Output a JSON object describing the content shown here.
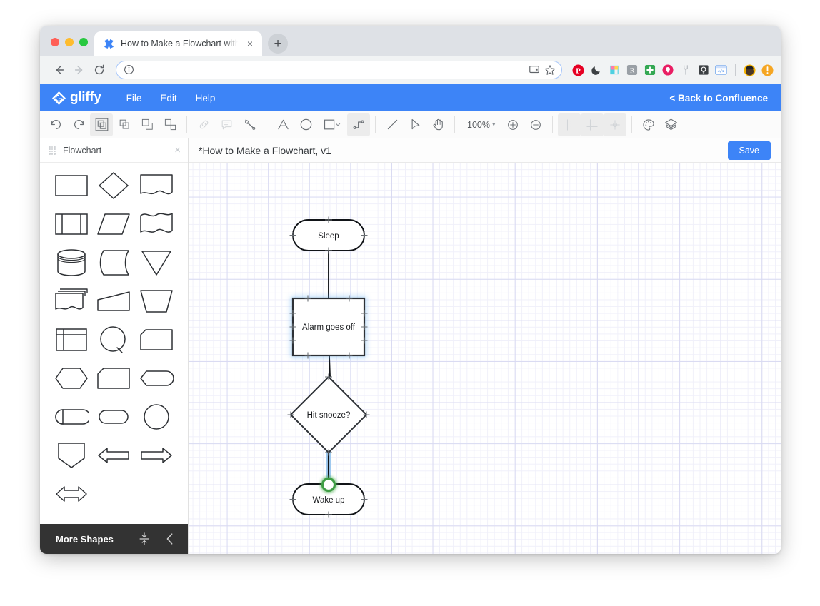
{
  "browser": {
    "tab": {
      "title": "How to Make a Flowchart with",
      "favicon": "gliffy-favicon",
      "close": "×"
    },
    "new_tab_label": "+",
    "omnibox": {
      "value": "",
      "placeholder": "",
      "info_icon": "site-info-icon"
    },
    "nav": {
      "back": "←",
      "forward": "→",
      "reload": "↻"
    },
    "toolbar_icons": [
      {
        "name": "cast-icon",
        "glyph": "",
        "color": "#5f6368"
      },
      {
        "name": "bookmark-star-icon",
        "glyph": "☆",
        "color": "#5f6368"
      },
      {
        "name": "pinterest-extension-icon",
        "glyph": "P",
        "color": "#e60023"
      },
      {
        "name": "dark-mode-extension-icon",
        "glyph": "☾",
        "color": "#3c4043"
      },
      {
        "name": "color-picker-extension-icon",
        "glyph": "",
        "color": "#4dd0e1"
      },
      {
        "name": "grammar-extension-icon",
        "glyph": "R",
        "color": "#9aa0a6"
      },
      {
        "name": "add-extension-icon",
        "glyph": "+",
        "color": "#34a853"
      },
      {
        "name": "tag-extension-icon",
        "glyph": "●",
        "color": "#e91e63"
      },
      {
        "name": "tools-extension-icon",
        "glyph": "⑂",
        "color": "#bdc1c6"
      },
      {
        "name": "lightbulb-extension-icon",
        "glyph": "●",
        "color": "#3c4043"
      },
      {
        "name": "code-extension-icon",
        "glyph": "</>",
        "color": "#1a73e8"
      }
    ],
    "profile_avatar": "user-avatar",
    "update_badge": "!"
  },
  "app": {
    "brand": "gliffy",
    "menu": [
      {
        "label": "File",
        "name": "menu-file"
      },
      {
        "label": "Edit",
        "name": "menu-edit"
      },
      {
        "label": "Help",
        "name": "menu-help"
      }
    ],
    "back_link": "< Back to Confluence",
    "accent_color": "#3d84f7"
  },
  "toolbar": {
    "zoom_level": "100%",
    "groups": [
      {
        "name": "history",
        "tools": [
          {
            "name": "undo-icon",
            "label": "Undo",
            "disabled": false
          },
          {
            "name": "redo-icon",
            "label": "Redo",
            "disabled": false
          }
        ]
      },
      {
        "name": "arrange",
        "tools": [
          {
            "name": "group-icon",
            "label": "Group",
            "disabled": false,
            "active": true
          },
          {
            "name": "ungroup-icon",
            "label": "Ungroup",
            "disabled": false
          },
          {
            "name": "bring-to-front-icon",
            "label": "Bring to front",
            "disabled": false
          },
          {
            "name": "send-to-back-icon",
            "label": "Send to back",
            "disabled": false
          }
        ]
      },
      {
        "name": "annotate",
        "tools": [
          {
            "name": "link-icon",
            "label": "Link",
            "disabled": true
          },
          {
            "name": "comment-icon",
            "label": "Comment",
            "disabled": true
          },
          {
            "name": "format-painter-icon",
            "label": "Format painter",
            "disabled": false
          }
        ]
      },
      {
        "name": "draw",
        "tools": [
          {
            "name": "text-icon",
            "label": "Text",
            "disabled": false
          },
          {
            "name": "ellipse-icon",
            "label": "Ellipse",
            "disabled": false
          },
          {
            "name": "rectangle-icon",
            "label": "Rectangle",
            "disabled": false,
            "has_caret": true
          },
          {
            "name": "connector-icon",
            "label": "Connector",
            "disabled": false,
            "active": true
          }
        ]
      },
      {
        "name": "select",
        "tools": [
          {
            "name": "line-icon",
            "label": "Line",
            "disabled": false
          },
          {
            "name": "pointer-icon",
            "label": "Select",
            "disabled": false
          },
          {
            "name": "hand-icon",
            "label": "Pan",
            "disabled": false
          }
        ]
      },
      {
        "name": "zoom",
        "tools": [
          {
            "name": "zoom-in-icon",
            "label": "Zoom in",
            "disabled": false
          },
          {
            "name": "zoom-out-icon",
            "label": "Zoom out",
            "disabled": false
          }
        ]
      },
      {
        "name": "view",
        "tools": [
          {
            "name": "guides-icon",
            "label": "Guides",
            "disabled": false,
            "active": true
          },
          {
            "name": "grid-icon",
            "label": "Grid",
            "disabled": false,
            "active": true
          },
          {
            "name": "snap-icon",
            "label": "Snap",
            "disabled": false,
            "active": true
          }
        ]
      },
      {
        "name": "style",
        "tools": [
          {
            "name": "palette-icon",
            "label": "Theme",
            "disabled": false
          },
          {
            "name": "layers-icon",
            "label": "Layers",
            "disabled": false
          }
        ]
      }
    ]
  },
  "sidebar": {
    "panel_title": "Flowchart",
    "close_label": "×",
    "more_shapes_label": "More Shapes",
    "shapes": [
      {
        "name": "shape-process",
        "label": "Process"
      },
      {
        "name": "shape-decision",
        "label": "Decision"
      },
      {
        "name": "shape-document",
        "label": "Document"
      },
      {
        "name": "shape-predefined-process",
        "label": "Predefined Process"
      },
      {
        "name": "shape-data",
        "label": "Data"
      },
      {
        "name": "shape-multi-document",
        "label": "Multi Document"
      },
      {
        "name": "shape-database",
        "label": "Database"
      },
      {
        "name": "shape-stored-data",
        "label": "Stored Data"
      },
      {
        "name": "shape-merge",
        "label": "Merge"
      },
      {
        "name": "shape-stacked-document",
        "label": "Stacked Document"
      },
      {
        "name": "shape-manual-input",
        "label": "Manual Input"
      },
      {
        "name": "shape-manual-operation",
        "label": "Manual Operation"
      },
      {
        "name": "shape-internal-storage",
        "label": "Internal Storage"
      },
      {
        "name": "shape-connector-circle",
        "label": "Connector"
      },
      {
        "name": "shape-card",
        "label": "Card"
      },
      {
        "name": "shape-preparation",
        "label": "Preparation"
      },
      {
        "name": "shape-loop-limit",
        "label": "Loop Limit"
      },
      {
        "name": "shape-delay",
        "label": "Delay"
      },
      {
        "name": "shape-direct-access",
        "label": "Direct Access Storage"
      },
      {
        "name": "shape-terminator",
        "label": "Terminator"
      },
      {
        "name": "shape-circle",
        "label": "Circle"
      },
      {
        "name": "shape-extract",
        "label": "Extract"
      },
      {
        "name": "shape-arrow-left",
        "label": "Arrow Left"
      },
      {
        "name": "shape-arrow-right",
        "label": "Arrow Right"
      },
      {
        "name": "shape-arrow-double",
        "label": "Double Arrow"
      }
    ]
  },
  "document": {
    "title": "*How to Make a Flowchart, v1",
    "save_label": "Save"
  },
  "diagram": {
    "nodes": [
      {
        "id": "n1",
        "name": "node-sleep",
        "label": "Sleep",
        "shape": "terminator",
        "selected": false
      },
      {
        "id": "n2",
        "name": "node-alarm-goes-off",
        "label": "Alarm goes off",
        "shape": "rectangle",
        "selected": true
      },
      {
        "id": "n3",
        "name": "node-hit-snooze",
        "label": "Hit snooze?",
        "shape": "diamond",
        "selected": false
      },
      {
        "id": "n4",
        "name": "node-wake-up",
        "label": "Wake up",
        "shape": "terminator",
        "selected": false
      }
    ],
    "connectors": [
      {
        "name": "connector-sleep-to-alarm",
        "from": "n1",
        "to": "n2",
        "highlighted": false
      },
      {
        "name": "connector-alarm-to-snooze",
        "from": "n2",
        "to": "n3",
        "highlighted": false
      },
      {
        "name": "connector-snooze-to-wake",
        "from": "n3",
        "to": "n4",
        "highlighted": true
      }
    ],
    "selection_color": "#4aa3f0",
    "endpoint_color": "#4caf50"
  }
}
